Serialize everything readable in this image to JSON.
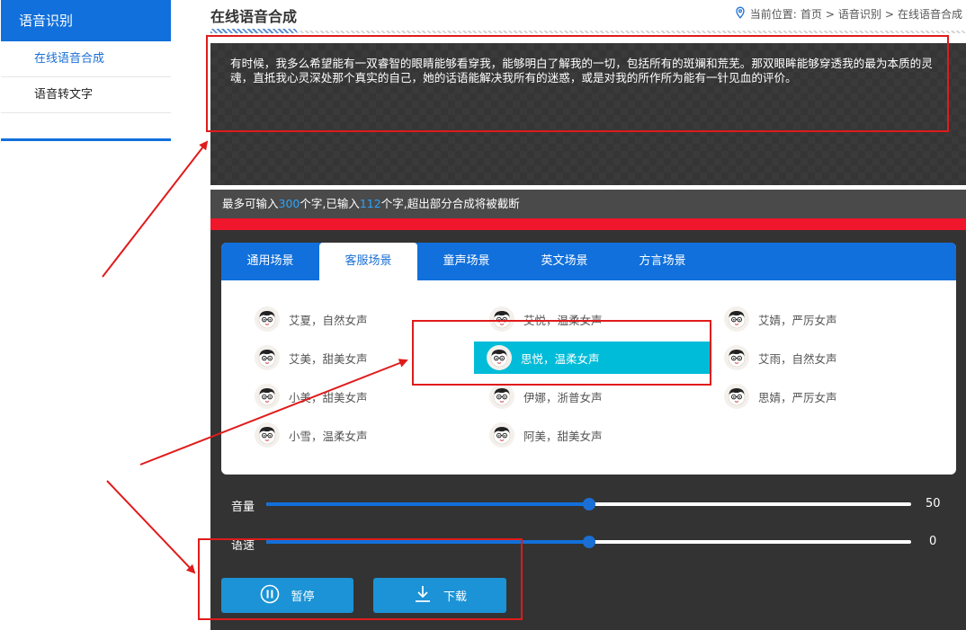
{
  "sidebar": {
    "title": "语音识别",
    "items": [
      {
        "label": "在线语音合成"
      },
      {
        "label": "语音转文字"
      }
    ]
  },
  "header": {
    "title": "在线语音合成",
    "breadcrumb_prefix": "当前位置:",
    "breadcrumb": [
      "首页",
      "语音识别",
      "在线语音合成"
    ],
    "separator": ">"
  },
  "editor": {
    "text": "有时候，我多么希望能有一双睿智的眼睛能够看穿我，能够明白了解我的一切，包括所有的斑斓和荒芜。那双眼眸能够穿透我的最为本质的灵魂，直抵我心灵深处那个真实的自己，她的话语能解决我所有的迷惑，或是对我的所作所为能有一针见血的评价。",
    "info_prefix": "最多可输入",
    "max_chars": "300",
    "info_mid": "个字,已输入",
    "input_chars": "112",
    "info_suffix": "个字,超出部分合成将被截断"
  },
  "tabs": [
    {
      "label": "通用场景"
    },
    {
      "label": "客服场景"
    },
    {
      "label": "童声场景"
    },
    {
      "label": "英文场景"
    },
    {
      "label": "方言场景"
    }
  ],
  "active_tab": 1,
  "voices": [
    {
      "label": "艾夏，自然女声"
    },
    {
      "label": "艾悦，温柔女声"
    },
    {
      "label": "艾婧，严厉女声"
    },
    {
      "label": "艾美，甜美女声"
    },
    {
      "label": "思悦，温柔女声"
    },
    {
      "label": "艾雨，自然女声"
    },
    {
      "label": "小美，甜美女声"
    },
    {
      "label": "伊娜，浙普女声"
    },
    {
      "label": "思婧，严厉女声"
    },
    {
      "label": "小雪，温柔女声"
    },
    {
      "label": "阿美，甜美女声"
    }
  ],
  "selected_voice": 4,
  "sliders": {
    "volume": {
      "label": "音量",
      "value": "50",
      "position": 0.5
    },
    "speed": {
      "label": "语速",
      "value": "0",
      "position": 0.5
    }
  },
  "buttons": {
    "pause": "暂停",
    "download": "下载"
  },
  "colors": {
    "accent": "#1170db",
    "selected": "#00bcd8",
    "button": "#1b93d6",
    "annotation": "#e01b1b",
    "warning_bar": "#f0162c"
  }
}
